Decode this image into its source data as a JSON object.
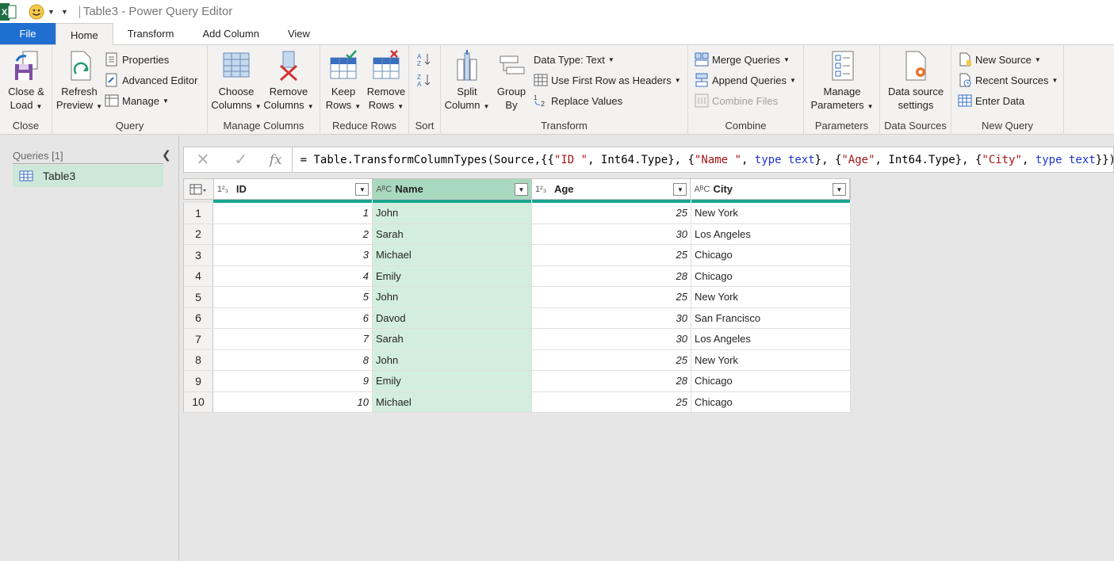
{
  "window": {
    "title": "Table3 - Power Query Editor"
  },
  "tabs": [
    {
      "label": "File"
    },
    {
      "label": "Home"
    },
    {
      "label": "Transform"
    },
    {
      "label": "Add Column"
    },
    {
      "label": "View"
    }
  ],
  "ribbon": {
    "close": {
      "btn1": "Close &",
      "btn2": "Load",
      "label": "Close"
    },
    "query": {
      "refresh1": "Refresh",
      "refresh2": "Preview",
      "properties": "Properties",
      "advanced_editor": "Advanced Editor",
      "manage": "Manage",
      "label": "Query"
    },
    "manage_columns": {
      "choose1": "Choose",
      "choose2": "Columns",
      "remove1": "Remove",
      "remove2": "Columns",
      "label": "Manage Columns"
    },
    "reduce_rows": {
      "keep1": "Keep",
      "keep2": "Rows",
      "remove1": "Remove",
      "remove2": "Rows",
      "label": "Reduce Rows"
    },
    "sort": {
      "label": "Sort"
    },
    "transform": {
      "split1": "Split",
      "split2": "Column",
      "group1": "Group",
      "group2": "By",
      "data_type": "Data Type: Text",
      "first_row": "Use First Row as Headers",
      "replace": "Replace Values",
      "label": "Transform"
    },
    "combine": {
      "merge": "Merge Queries",
      "append": "Append Queries",
      "combine_files": "Combine Files",
      "label": "Combine"
    },
    "parameters": {
      "manage1": "Manage",
      "manage2": "Parameters",
      "label": "Parameters"
    },
    "data_sources": {
      "ds1": "Data source",
      "ds2": "settings",
      "label": "Data Sources"
    },
    "new_query": {
      "new_source": "New Source",
      "recent_sources": "Recent Sources",
      "enter_data": "Enter Data",
      "label": "New Query"
    }
  },
  "queries": {
    "header": "Queries [1]",
    "items": [
      {
        "label": "Table3"
      }
    ]
  },
  "formula": {
    "p1": "= Table.TransformColumnTypes(Source,{{",
    "s1": "\"ID \"",
    "p2": ", Int64.Type}, {",
    "s2": "\"Name \"",
    "p3": ", ",
    "k1": "type text",
    "p4": "}, {",
    "s3": "\"Age\"",
    "p5": ", Int64.Type}, {",
    "s4": "\"City\"",
    "p6": ", ",
    "k2": "type text",
    "p7": "}})"
  },
  "table": {
    "columns": [
      {
        "name": "ID",
        "type_icon": "1²₃"
      },
      {
        "name": "Name",
        "type_icon": "AᴮC"
      },
      {
        "name": "Age",
        "type_icon": "1²₃"
      },
      {
        "name": "City",
        "type_icon": "AᴮC"
      }
    ],
    "rows": [
      {
        "n": "1",
        "id": "1",
        "name": "John",
        "age": "25",
        "city": "New York"
      },
      {
        "n": "2",
        "id": "2",
        "name": "Sarah",
        "age": "30",
        "city": "Los Angeles"
      },
      {
        "n": "3",
        "id": "3",
        "name": "Michael",
        "age": "25",
        "city": "Chicago"
      },
      {
        "n": "4",
        "id": "4",
        "name": "Emily",
        "age": "28",
        "city": "Chicago"
      },
      {
        "n": "5",
        "id": "5",
        "name": "John",
        "age": "25",
        "city": "New York"
      },
      {
        "n": "6",
        "id": "6",
        "name": "Davod",
        "age": "30",
        "city": "San Francisco"
      },
      {
        "n": "7",
        "id": "7",
        "name": "Sarah",
        "age": "30",
        "city": "Los Angeles"
      },
      {
        "n": "8",
        "id": "8",
        "name": "John",
        "age": "25",
        "city": "New York"
      },
      {
        "n": "9",
        "id": "9",
        "name": "Emily",
        "age": "28",
        "city": "Chicago"
      },
      {
        "n": "10",
        "id": "10",
        "name": "Michael",
        "age": "25",
        "city": "Chicago"
      }
    ]
  },
  "colors": {
    "accent": "#1f6fd0",
    "quality": "#19a690",
    "selected_col": "#d3eedf"
  }
}
